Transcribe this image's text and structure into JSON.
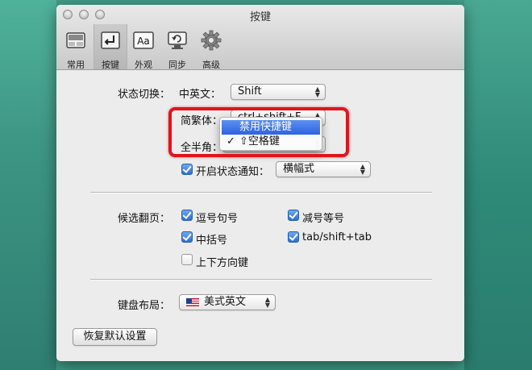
{
  "window": {
    "title": "按键"
  },
  "toolbar": {
    "items": [
      {
        "label": "常用",
        "icon": "general-icon"
      },
      {
        "label": "按键",
        "icon": "keyboard-icon",
        "active": true
      },
      {
        "label": "外观",
        "icon": "appearance-icon"
      },
      {
        "label": "同步",
        "icon": "sync-icon"
      },
      {
        "label": "高级",
        "icon": "gear-icon"
      }
    ]
  },
  "state_switch": {
    "section_label": "状态切换：",
    "cn_en_label": "中英文：",
    "cn_en_value": "Shift",
    "trad_simp_label": "简繁体：",
    "trad_simp_value": "ctrl+shift+F",
    "full_half_label": "全半角：",
    "notify_label": "开启状态通知：",
    "notify_checked": true,
    "notify_value": "横幅式"
  },
  "dropdown_menu": {
    "items": [
      {
        "label": "禁用快捷键",
        "highlighted": true,
        "checked": false
      },
      {
        "label": "⇧空格键",
        "highlighted": false,
        "checked": true,
        "check_mark": "✓"
      }
    ]
  },
  "candidate_paging": {
    "section_label": "候选翻页：",
    "options": [
      {
        "label": "逗号句号",
        "checked": true
      },
      {
        "label": "减号等号",
        "checked": true
      },
      {
        "label": "中括号",
        "checked": true
      },
      {
        "label": "tab/shift+tab",
        "checked": true
      },
      {
        "label": "上下方向键",
        "checked": false
      }
    ]
  },
  "keyboard_layout": {
    "section_label": "键盘布局：",
    "value": "美式英文"
  },
  "restore_button": {
    "label": "恢复默认设置"
  },
  "colors": {
    "highlight_box": "#e0141c",
    "menu_highlight": "#2c63e0",
    "checkbox_on": "#2c6fd4"
  }
}
